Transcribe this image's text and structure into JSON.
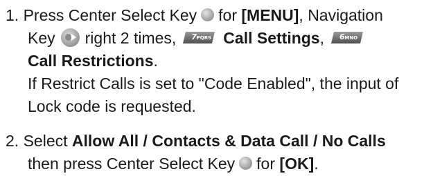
{
  "steps": [
    {
      "number": "1.",
      "line1": {
        "t1": "Press Center Select Key",
        "t2": "for",
        "b1": "[MENU]",
        "t3": ", Navigation"
      },
      "line2": {
        "t1": "Key",
        "t2": "right 2 times,",
        "b1": "Call Settings",
        "t3": ","
      },
      "line3": {
        "b1": "Call Restrictions",
        "t1": "."
      },
      "line4": "If Restrict Calls is set to \"Code Enabled\", the input of",
      "line5": "Lock code is requested."
    },
    {
      "number": "2.",
      "line1": {
        "t1": "Select",
        "b1": "Allow All / Contacts & Data Call / No Calls"
      },
      "line2": {
        "t1": "then press Center Select Key",
        "t2": "for",
        "b1": "[OK]",
        "t3": "."
      }
    }
  ],
  "keys": {
    "key7": {
      "digit": "7",
      "letters": "PQRS"
    },
    "key6": {
      "digit": "6",
      "letters": "MNO"
    }
  },
  "icons": {
    "center_select": "center-select-key-icon",
    "navigation": "navigation-key-right-icon"
  },
  "colors": {
    "text": "#1a1a1a",
    "key_badge": "#6e6e6e",
    "key_highlight": "#c0c0c0"
  }
}
